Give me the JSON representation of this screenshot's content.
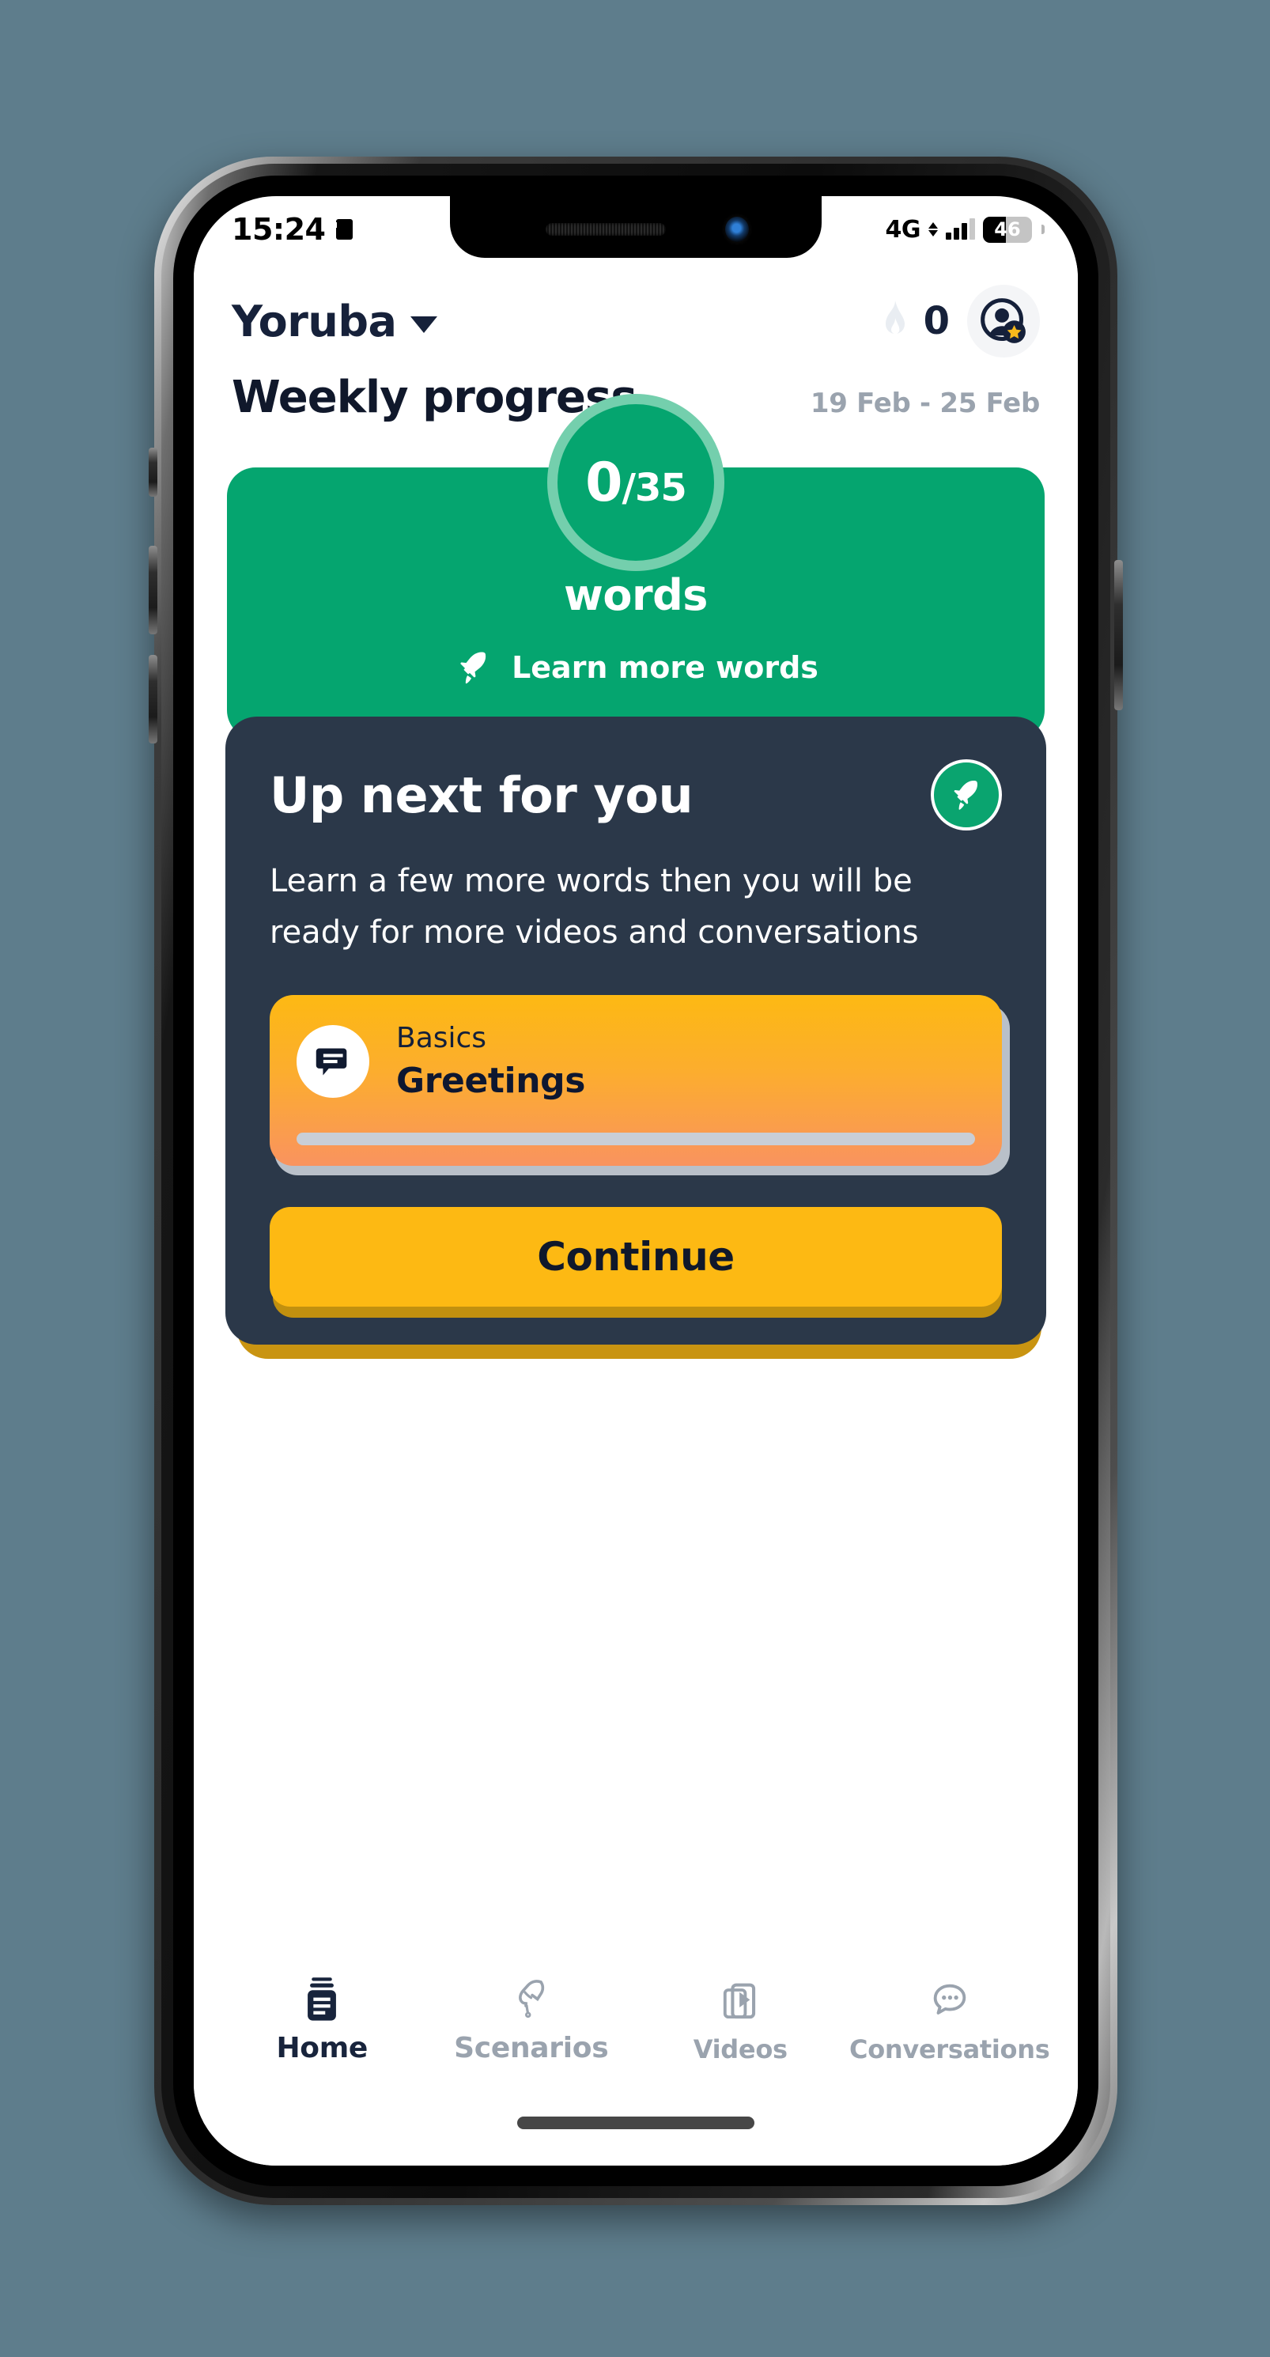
{
  "status_bar": {
    "time": "15:24",
    "sim_icon": "sim-card-icon",
    "network": "4G",
    "battery_percent": "46",
    "battery_level": 46,
    "signal_bars_filled": 3,
    "signal_bars_total": 4
  },
  "header": {
    "language": "Yoruba",
    "language_chevron_icon": "chevron-down-icon",
    "streak_icon": "flame-icon",
    "streak_count": "0",
    "avatar_icon": "avatar-star-icon"
  },
  "weekly": {
    "title": "Weekly progress",
    "date_range": "19 Feb - 25 Feb"
  },
  "progress": {
    "current": "0",
    "separator": "/",
    "goal": "35",
    "unit_label": "words",
    "cta_label": "Learn more words",
    "cta_icon": "rocket-icon"
  },
  "up_next": {
    "title": "Up next for you",
    "badge_icon": "rocket-icon",
    "body": "Learn a few more words then you will be ready for more videos and conversations",
    "lesson": {
      "icon": "chat-bubble-icon",
      "category": "Basics",
      "name": "Greetings",
      "progress_percent": 0
    },
    "continue_label": "Continue"
  },
  "bottom_nav": {
    "items": [
      {
        "label": "Home",
        "icon": "book-stack-icon",
        "active": true
      },
      {
        "label": "Scenarios",
        "icon": "hand-icon",
        "active": false
      },
      {
        "label": "Videos",
        "icon": "video-play-icon",
        "active": false
      },
      {
        "label": "Conversations",
        "icon": "chat-dots-icon",
        "active": false
      }
    ]
  },
  "colors": {
    "background": "#5e7d8c",
    "green": "#05a56f",
    "green_ring": "#74cfad",
    "dark_navy": "#2b3849",
    "amber": "#fdb913",
    "amber_shadow": "#c1900f",
    "text_dark": "#10182b",
    "text_muted": "#9aa3ae"
  }
}
